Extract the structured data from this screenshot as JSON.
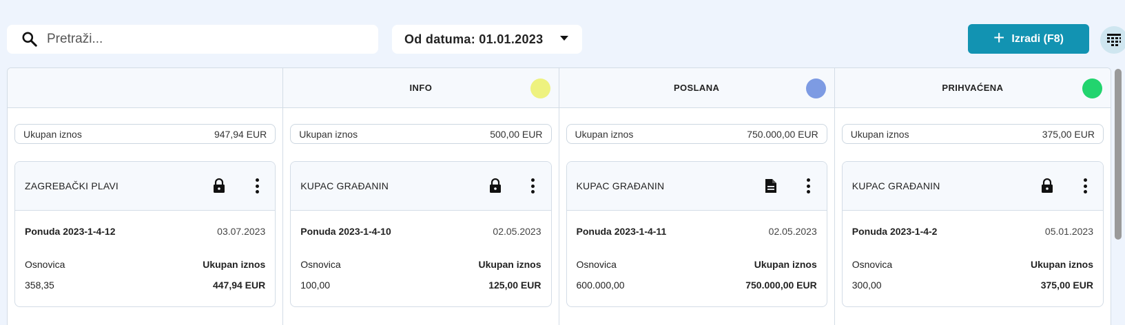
{
  "search": {
    "placeholder": "Pretraži..."
  },
  "date_filter": {
    "label": "Od datuma: 01.01.2023"
  },
  "create_button": {
    "label": "Izradi (F8)"
  },
  "colors": {
    "accent": "#1293b2",
    "info": "#eef27f",
    "poslana": "#7d9be3",
    "prihvacena": "#22d46e"
  },
  "columns": [
    {
      "title": "",
      "total_label": "Ukupan iznos",
      "total_value": "947,94 EUR",
      "cards": [
        {
          "customer": "ZAGREBAČKI PLAVI",
          "icon": "lock-icon",
          "offer": "Ponuda 2023-1-4-12",
          "date": "03.07.2023",
          "base_label": "Osnovica",
          "total_label": "Ukupan iznos",
          "base_value": "358,35",
          "total_value": "447,94 EUR"
        }
      ]
    },
    {
      "title": "INFO",
      "total_label": "Ukupan iznos",
      "total_value": "500,00 EUR",
      "cards": [
        {
          "customer": "KUPAC GRAĐANIN",
          "icon": "lock-icon",
          "offer": "Ponuda 2023-1-4-10",
          "date": "02.05.2023",
          "base_label": "Osnovica",
          "total_label": "Ukupan iznos",
          "base_value": "100,00",
          "total_value": "125,00 EUR"
        }
      ]
    },
    {
      "title": "POSLANA",
      "total_label": "Ukupan iznos",
      "total_value": "750.000,00 EUR",
      "cards": [
        {
          "customer": "KUPAC GRAĐANIN",
          "icon": "document-icon",
          "offer": "Ponuda 2023-1-4-11",
          "date": "02.05.2023",
          "base_label": "Osnovica",
          "total_label": "Ukupan iznos",
          "base_value": "600.000,00",
          "total_value": "750.000,00 EUR"
        }
      ]
    },
    {
      "title": "PRIHVAĆENA",
      "total_label": "Ukupan iznos",
      "total_value": "375,00 EUR",
      "cards": [
        {
          "customer": "KUPAC GRAĐANIN",
          "icon": "lock-icon",
          "offer": "Ponuda 2023-1-4-2",
          "date": "05.01.2023",
          "base_label": "Osnovica",
          "total_label": "Ukupan iznos",
          "base_value": "300,00",
          "total_value": "375,00 EUR"
        }
      ]
    }
  ]
}
